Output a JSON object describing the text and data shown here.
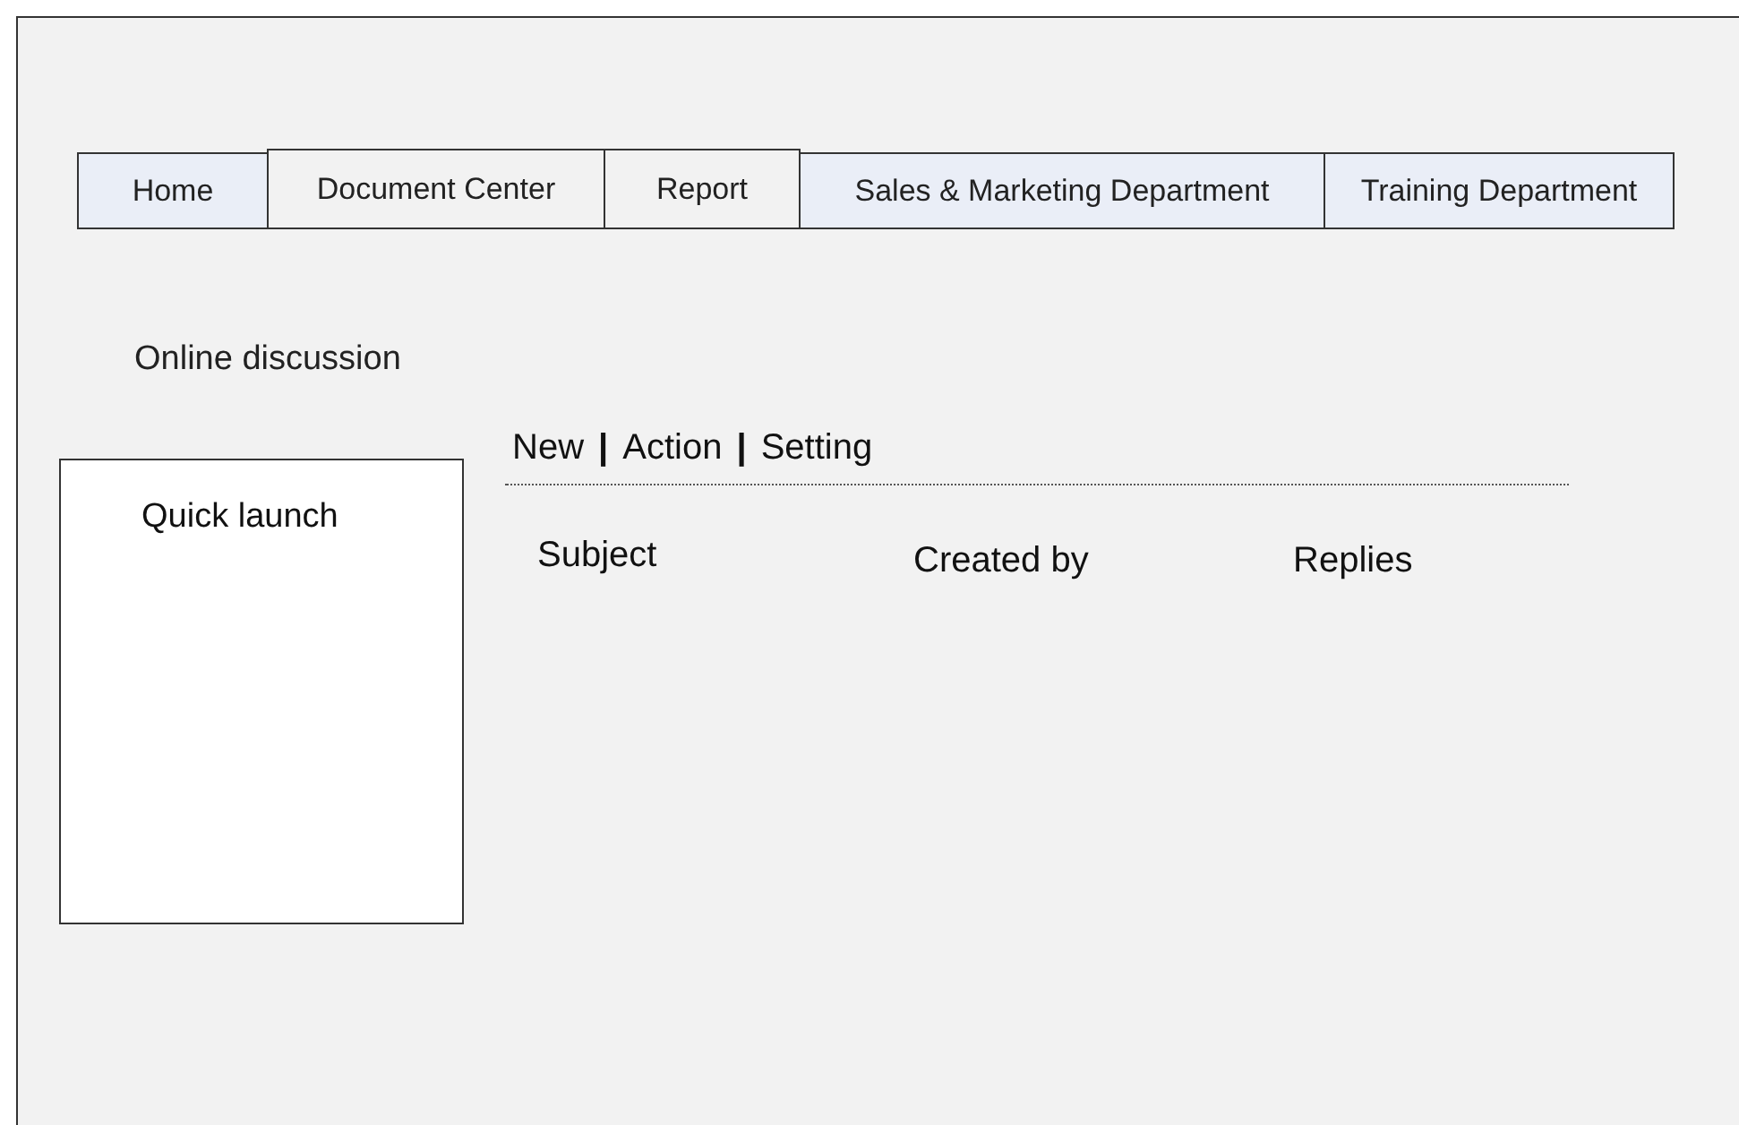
{
  "tabs": [
    {
      "label": "Home",
      "shaded": true
    },
    {
      "label": "Document Center",
      "shaded": false
    },
    {
      "label": "Report",
      "shaded": false
    },
    {
      "label": "Sales & Marketing Department",
      "shaded": true
    },
    {
      "label": "Training Department",
      "shaded": true
    }
  ],
  "page_title": "Online discussion",
  "quick_launch": {
    "title": "Quick launch"
  },
  "toolbar": [
    {
      "kind": "link",
      "label": "New"
    },
    {
      "kind": "separator",
      "label": "|"
    },
    {
      "kind": "link",
      "label": "Action"
    },
    {
      "kind": "separator",
      "label": "|"
    },
    {
      "kind": "link",
      "label": "Setting"
    }
  ],
  "columns": [
    "Subject",
    "Created by",
    "Replies"
  ]
}
